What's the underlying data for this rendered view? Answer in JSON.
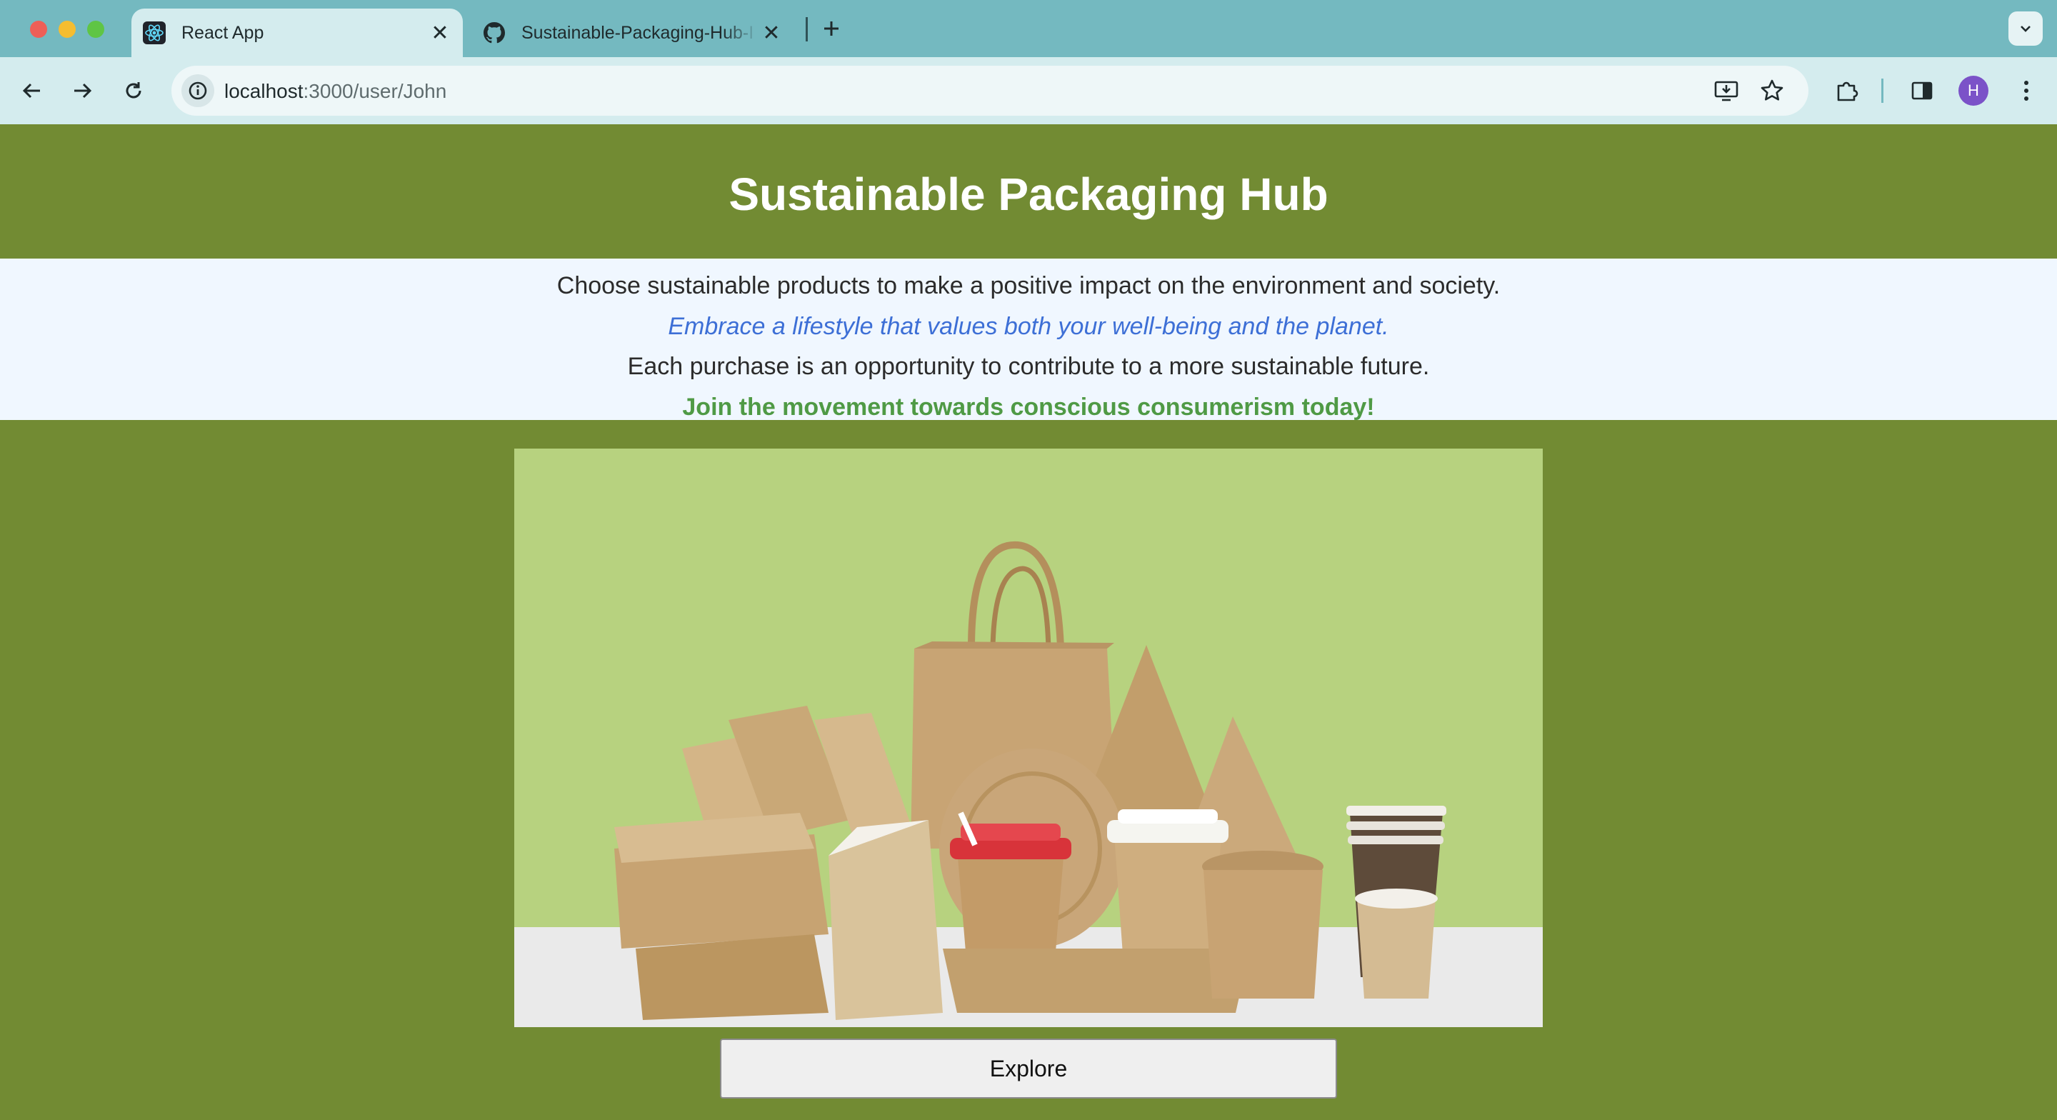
{
  "browser": {
    "tabs": [
      {
        "title": "React App",
        "active": true,
        "icon": "react-icon"
      },
      {
        "title": "Sustainable-Packaging-Hub-I",
        "active": false,
        "icon": "github-icon"
      }
    ],
    "close_glyph": "✕",
    "new_tab_icon": "plus-icon",
    "address": {
      "host": "localhost",
      "path": ":3000/user/John"
    },
    "profile_initial": "H",
    "colors": {
      "tabbar": "#74b9c0",
      "toolbar": "#d4ecee",
      "avatar": "#7b52c8"
    }
  },
  "page": {
    "title": "Sustainable Packaging Hub",
    "intro": [
      "Choose sustainable products to make a positive impact on the environment and society.",
      "Embrace a lifestyle that values both your well-being and the planet.",
      "Each purchase is an opportunity to contribute to a more sustainable future.",
      "Join the movement towards conscious consumerism today!"
    ],
    "hero_image": "eco-friendly kraft paper packaging: bags, boxes, cups and plates",
    "explore_label": "Explore",
    "colors": {
      "background": "#728b33",
      "intro_bg": "#f0f7ff",
      "italic_text": "#3d6fd6",
      "cta_text": "#4f9a45",
      "hero_bg": "#b7d27f"
    }
  }
}
